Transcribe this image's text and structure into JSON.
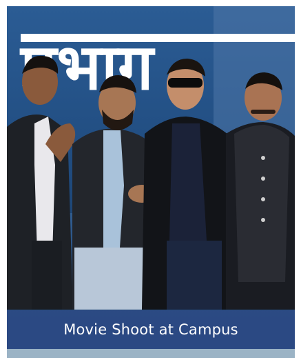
{
  "caption": {
    "text": "Movie Shoot at Campus"
  },
  "banner": {
    "text": "प्रभाग"
  },
  "colors": {
    "caption_background": "#2c4a84",
    "caption_text": "#ffffff",
    "backdrop": "#254b7a"
  }
}
